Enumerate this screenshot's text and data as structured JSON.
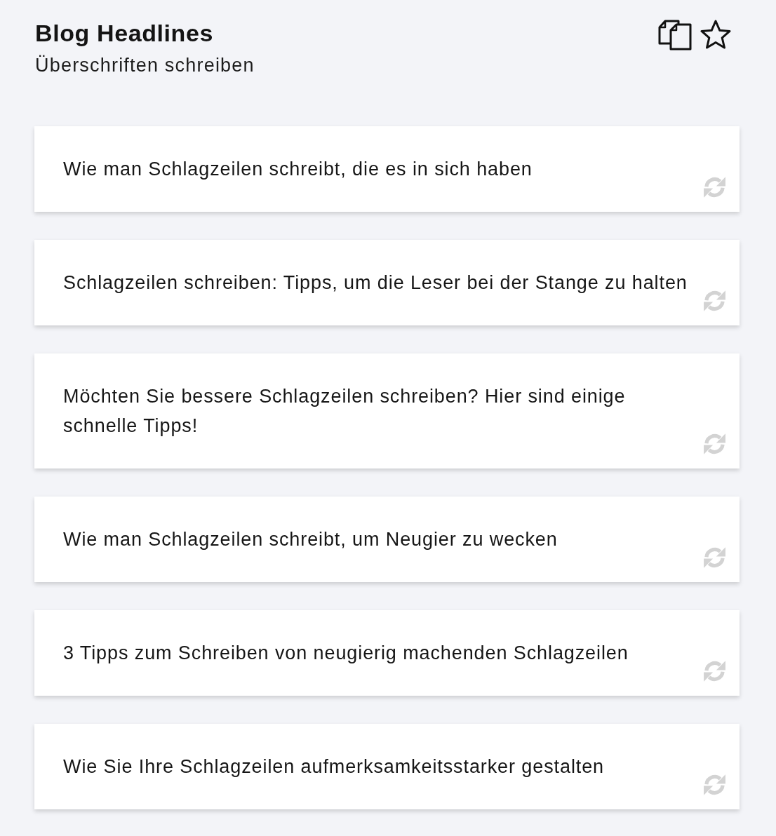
{
  "header": {
    "title": "Blog Headlines",
    "subtitle": "Überschriften schreiben",
    "starred": false
  },
  "headlines": [
    {
      "text": "Wie man Schlagzeilen schreibt, die es in sich haben"
    },
    {
      "text": "Schlagzeilen schreiben: Tipps, um die Leser bei der Stange zu halten"
    },
    {
      "text": "Möchten Sie bessere Schlagzeilen schreiben? Hier sind einige schnelle Tipps!"
    },
    {
      "text": "Wie man Schlagzeilen schreibt, um Neugier zu wecken"
    },
    {
      "text": "3 Tipps zum Schreiben von neugierig machenden Schlagzeilen"
    },
    {
      "text": "Wie Sie Ihre Schlagzeilen aufmerksamkeitsstarker gestalten"
    }
  ]
}
